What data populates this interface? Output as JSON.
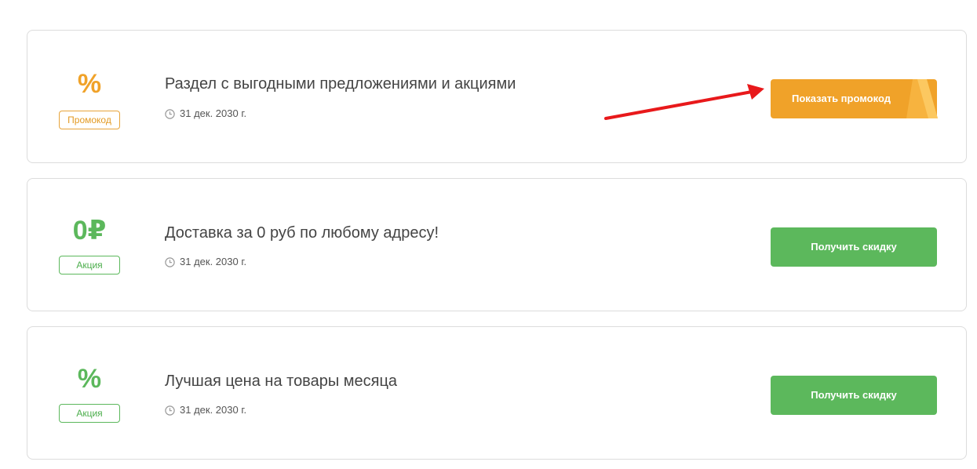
{
  "offers": [
    {
      "value": "%",
      "tag": "Промокод",
      "title": "Раздел с выгодными предложениями и акциями",
      "date": "31 дек. 2030 г.",
      "button": "Показать промокод"
    },
    {
      "value": "0₽",
      "tag": "Акция",
      "title": "Доставка за 0 руб по любому адресу!",
      "date": "31 дек. 2030 г.",
      "button": "Получить скидку"
    },
    {
      "value": "%",
      "tag": "Акция",
      "title": "Лучшая цена на товары месяца",
      "date": "31 дек. 2030 г.",
      "button": "Получить скидку"
    }
  ],
  "colors": {
    "orange": "#f0a229",
    "green": "#5cb85c",
    "arrow": "#e8191b",
    "border": "#dcdcdc"
  },
  "icons": {
    "date": "clock-icon",
    "annotation": "red-arrow-icon"
  }
}
